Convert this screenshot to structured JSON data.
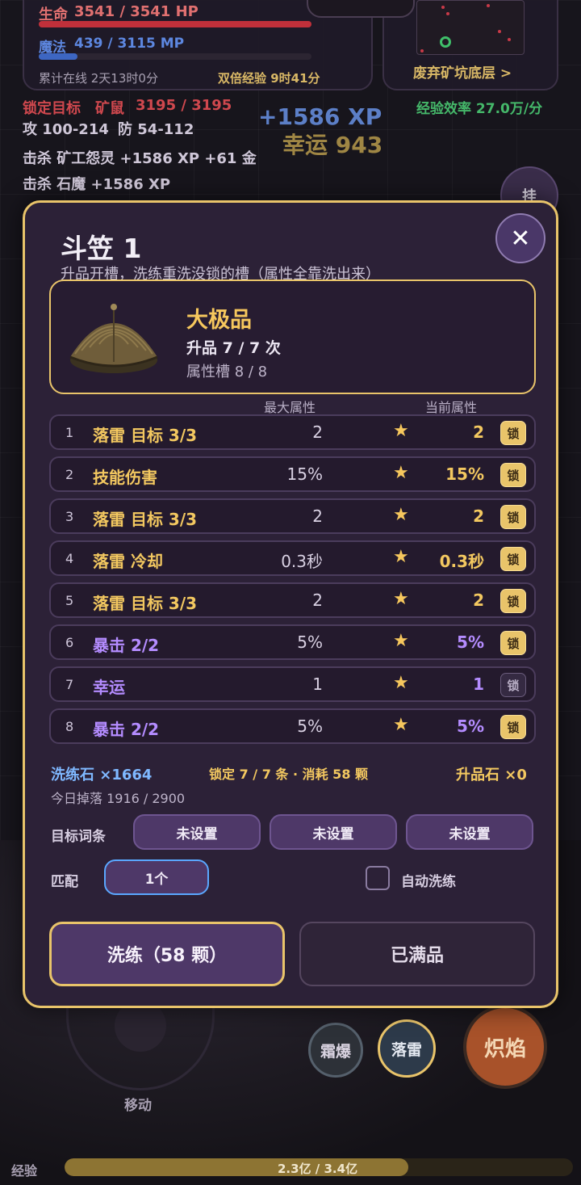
{
  "hud": {
    "hp_label": "生命",
    "hp_text": "3541 / 3541 HP",
    "hp_ratio": 1.0,
    "mp_label": "魔法",
    "mp_text": "439 / 3115 MP",
    "mp_ratio": 0.141,
    "online_time": "累计在线 2天13时0分",
    "double_exp": "双倍经验 9时41分",
    "area_name": "废弃矿坑底层 >",
    "exp_efficiency": "经验效率 27.0万/分",
    "target_label": "锁定目标",
    "target_name": "矿鼠",
    "target_hp": "3195 / 3195",
    "atk": "攻 100-214",
    "def": "防 54-112",
    "log": [
      "击杀 矿工怨灵 +1586 XP +61 金",
      "击杀 石魔 +1586 XP"
    ],
    "float_xp": "+1586 XP",
    "float_luck": "幸运 943",
    "hang_label": "挂",
    "skills": [
      "霜爆",
      "落雷",
      "炽焰"
    ],
    "move_label": "移动",
    "exp_label": "经验",
    "exp_text": "2.3亿 / 3.4亿",
    "exp_ratio": 0.676
  },
  "modal": {
    "title": "斗笠 1",
    "subtitle": "升品开槽，洗练重洗没锁的槽（属性全靠洗出来）",
    "close_icon": "✕",
    "item": {
      "grade": "大极品",
      "upgrade": "升品 7 / 7 次",
      "slots": "属性槽 8 / 8"
    },
    "col_max": "最大属性",
    "col_current": "当前属性",
    "lock_label": "锁",
    "star_glyph": "★",
    "attributes": [
      {
        "idx": "1",
        "name": "落雷 目标 3/3",
        "max": "2",
        "current": "2",
        "tier": "gold",
        "locked": true
      },
      {
        "idx": "2",
        "name": "技能伤害",
        "max": "15%",
        "current": "15%",
        "tier": "gold",
        "locked": true
      },
      {
        "idx": "3",
        "name": "落雷 目标 3/3",
        "max": "2",
        "current": "2",
        "tier": "gold",
        "locked": true
      },
      {
        "idx": "4",
        "name": "落雷 冷却",
        "max": "0.3秒",
        "current": "0.3秒",
        "tier": "gold",
        "locked": true
      },
      {
        "idx": "5",
        "name": "落雷 目标 3/3",
        "max": "2",
        "current": "2",
        "tier": "gold",
        "locked": true
      },
      {
        "idx": "6",
        "name": "暴击 2/2",
        "max": "5%",
        "current": "5%",
        "tier": "purple",
        "locked": true
      },
      {
        "idx": "7",
        "name": "幸运",
        "max": "1",
        "current": "1",
        "tier": "purple",
        "locked": false
      },
      {
        "idx": "8",
        "name": "暴击 2/2",
        "max": "5%",
        "current": "5%",
        "tier": "purple",
        "locked": true
      }
    ],
    "refine_stone": "洗练石 ×1664",
    "lock_info": "锁定 7 / 7 条 · 消耗 58 颗",
    "upgrade_stone": "升品石 ×0",
    "daily_drop": "今日掉落 1916 / 2900",
    "target_label": "目标词条",
    "targets": [
      "未设置",
      "未设置",
      "未设置"
    ],
    "match_label": "匹配",
    "match_value": "1个",
    "auto_refine": "自动洗练",
    "refine_button": "洗练（58 颗）",
    "maxed_button": "已满品"
  },
  "colors": {
    "accent_gold": "#e9c46a",
    "gold_text": "#f3c860",
    "purple_text": "#b48cff",
    "refine_stone_blue": "#7fb8ff"
  }
}
